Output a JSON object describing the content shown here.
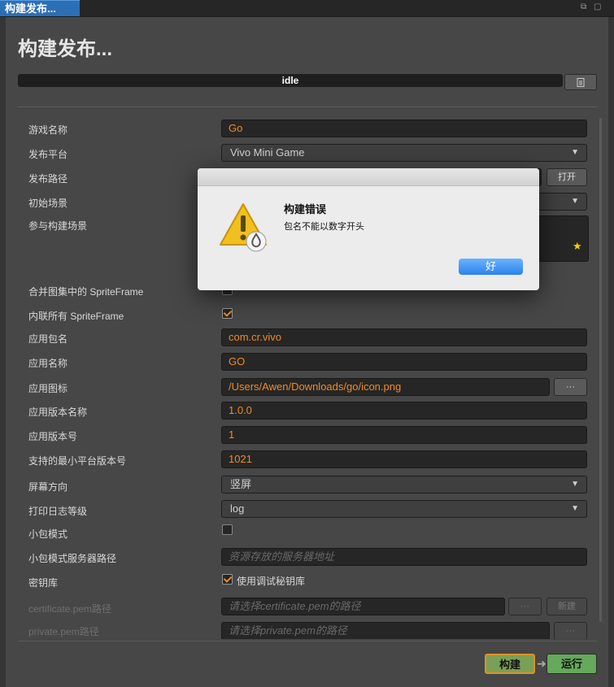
{
  "tab": {
    "label": "构建发布..."
  },
  "page_title": "构建发布...",
  "status": {
    "text": "idle"
  },
  "fields": {
    "game_name": {
      "label": "游戏名称",
      "value": "Go"
    },
    "platform": {
      "label": "发布平台",
      "value": "Vivo Mini Game"
    },
    "build_path": {
      "label": "发布路径",
      "open_label": "打开"
    },
    "start_scene": {
      "label": "初始场景"
    },
    "included_scenes": {
      "label": "参与构建场景"
    },
    "merge_sprite": {
      "label": "合并图集中的 SpriteFrame"
    },
    "inline_sprite": {
      "label": "内联所有 SpriteFrame"
    },
    "package_name": {
      "label": "应用包名",
      "value": "com.cr.vivo"
    },
    "app_name": {
      "label": "应用名称",
      "value": "GO"
    },
    "app_icon": {
      "label": "应用图标",
      "value": "/Users/Awen/Downloads/go/icon.png",
      "button": "···"
    },
    "version_name": {
      "label": "应用版本名称",
      "value": "1.0.0"
    },
    "version_number": {
      "label": "应用版本号",
      "value": "1"
    },
    "min_platform": {
      "label": "支持的最小平台版本号",
      "value": "1021"
    },
    "orientation": {
      "label": "屏幕方向",
      "value": "竖屏"
    },
    "log_level": {
      "label": "打印日志等级",
      "value": "log"
    },
    "small_package": {
      "label": "小包模式"
    },
    "small_package_server": {
      "label": "小包模式服务器路径",
      "placeholder": "资源存放的服务器地址"
    },
    "keystore": {
      "label": "密钥库",
      "checkbox_label": "使用调试秘钥库"
    },
    "certificate": {
      "label": "certificate.pem路径",
      "placeholder": "请选择certificate.pem的路径",
      "browse": "···",
      "new": "新建"
    },
    "private": {
      "label": "private.pem路径",
      "placeholder": "请选择private.pem的路径",
      "browse": "···"
    }
  },
  "footer": {
    "build_label": "构建",
    "run_label": "运行"
  },
  "dialog": {
    "title": "构建错误",
    "message": "包名不能以数字开头",
    "ok_label": "好"
  },
  "colors": {
    "accent": "#f08a24",
    "tab": "#2b6fb6",
    "build": "#7aa058",
    "run": "#66a85c"
  }
}
